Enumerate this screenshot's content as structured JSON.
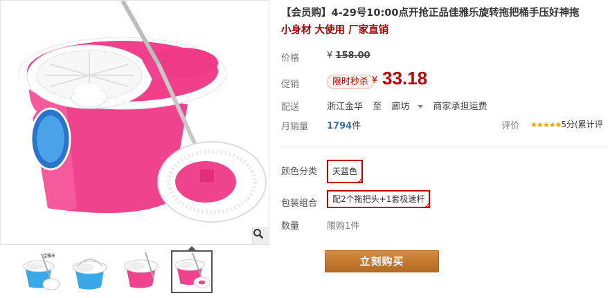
{
  "product": {
    "title": "【会员购】4-29号10:00点开抢正品佳雅乐旋转拖把桶手压好神拖",
    "subtitle": "小身材 大使用 厂家直销",
    "brand_on_bucket": "佳雅乐"
  },
  "gallery": {
    "zoom_icon": "magnifier-icon",
    "thumbnails": [
      {
        "color": "blue",
        "label": "佳雅乐"
      },
      {
        "color": "blue"
      },
      {
        "color": "pink"
      },
      {
        "color": "pink",
        "selected": true
      }
    ]
  },
  "price": {
    "label": "价格",
    "currency": "¥",
    "original": "158.00",
    "promo_label": "促销",
    "promo_tag": "限时秒杀",
    "current": "33.18"
  },
  "shipping": {
    "label": "配送",
    "from": "浙江金华",
    "to_word": "至",
    "destination": "廊坊",
    "fee_note": "商家承担运费"
  },
  "sales": {
    "label": "月销量",
    "count": "1794",
    "unit": "件",
    "rating_label": "评价",
    "stars": "★★★★★",
    "rating_text": "5分(累计评"
  },
  "sku": {
    "color_label": "颜色分类",
    "color_value": "天蓝色",
    "package_label": "包装组合",
    "package_value": "配2个拖把头+1套极速杆",
    "quantity_label": "数量",
    "quantity_limit": "限购1件"
  },
  "actions": {
    "buy_now": "立刻购买"
  },
  "colors": {
    "accent_red": "#c40000",
    "buy_button": "#c27832",
    "bucket_pink": "#f0438d",
    "bucket_blue": "#3aa7e6"
  }
}
